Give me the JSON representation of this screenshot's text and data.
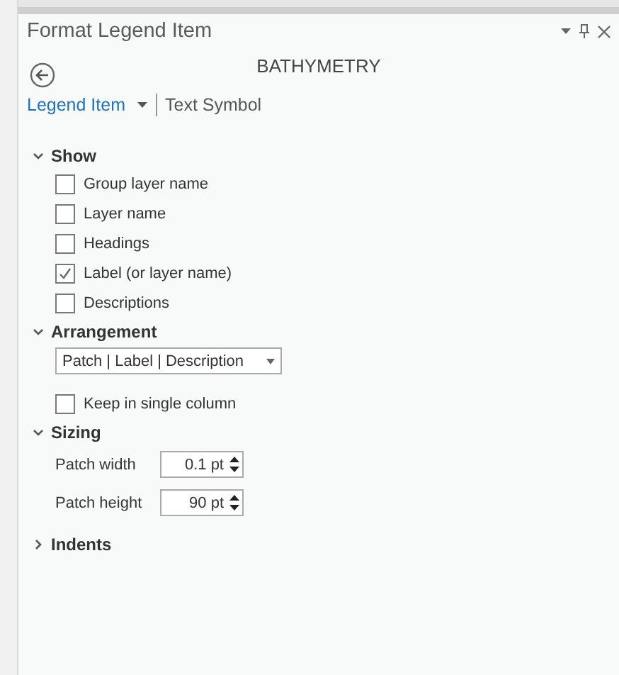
{
  "window": {
    "title": "Format Legend Item"
  },
  "header": {
    "layer": "BATHYMETRY"
  },
  "tabs": [
    {
      "label": "Legend Item",
      "selected": true,
      "dropdown": true
    },
    {
      "label": "Text Symbol",
      "selected": false,
      "dropdown": false
    }
  ],
  "sections": [
    {
      "title": "Show",
      "expanded": true,
      "items": [
        {
          "kind": "checkbox",
          "label": "Group layer name",
          "checked": false
        },
        {
          "kind": "checkbox",
          "label": "Layer name",
          "checked": false
        },
        {
          "kind": "checkbox",
          "label": "Headings",
          "checked": false
        },
        {
          "kind": "checkbox",
          "label": "Label (or layer name)",
          "checked": true
        },
        {
          "kind": "checkbox",
          "label": "Descriptions",
          "checked": false
        }
      ]
    },
    {
      "title": "Arrangement",
      "expanded": true,
      "items": [
        {
          "kind": "dropdown",
          "value": "Patch | Label | Description"
        },
        {
          "kind": "checkbox",
          "label": "Keep in single column",
          "checked": false
        }
      ]
    },
    {
      "title": "Sizing",
      "expanded": true,
      "items": [
        {
          "kind": "spinner",
          "label": "Patch width",
          "value": "0.1 pt"
        },
        {
          "kind": "spinner",
          "label": "Patch height",
          "value": "90 pt"
        }
      ]
    },
    {
      "title": "Indents",
      "expanded": false
    }
  ]
}
